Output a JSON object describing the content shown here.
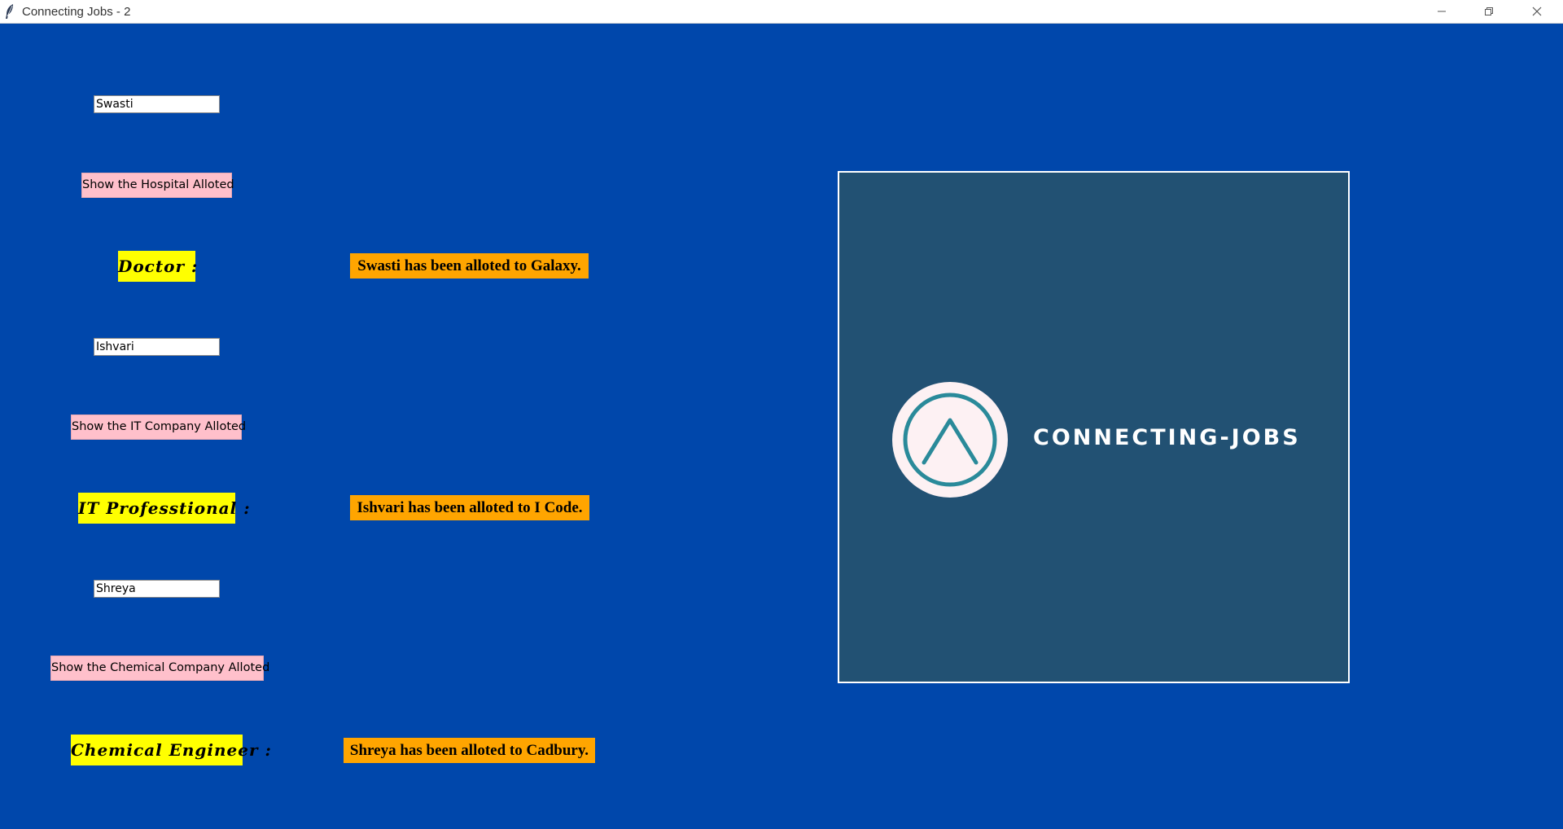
{
  "window": {
    "title": "Connecting Jobs - 2"
  },
  "colors": {
    "background": "#0047ab",
    "entry_bg": "#ffffff",
    "button_bg": "#ffc0cb",
    "role_label_bg": "#ffff00",
    "result_bg": "#ffa500",
    "logo_bg": "#225173",
    "logo_accent": "#2a8a9a"
  },
  "sections": {
    "doctor": {
      "name_value": "Swasti",
      "button_label": "Show the Hospital Alloted",
      "role_label": "Doctor :",
      "result_text": "Swasti has been alloted to Galaxy."
    },
    "it": {
      "name_value": "Ishvari",
      "button_label": "Show the IT Company Alloted",
      "role_label": "IT Professtional :",
      "result_text": "Ishvari has been alloted to I Code."
    },
    "chemical": {
      "name_value": "Shreya",
      "button_label": "Show the Chemical Company Alloted",
      "role_label": "Chemical Engineer :",
      "result_text": "Shreya has been alloted to Cadbury."
    }
  },
  "logo": {
    "text": "CONNECTING-JOBS",
    "icon": "chevron-up-circle-icon"
  },
  "icons": {
    "app": "feather-icon",
    "minimize": "minimize-icon",
    "restore": "restore-icon",
    "close": "close-icon"
  }
}
